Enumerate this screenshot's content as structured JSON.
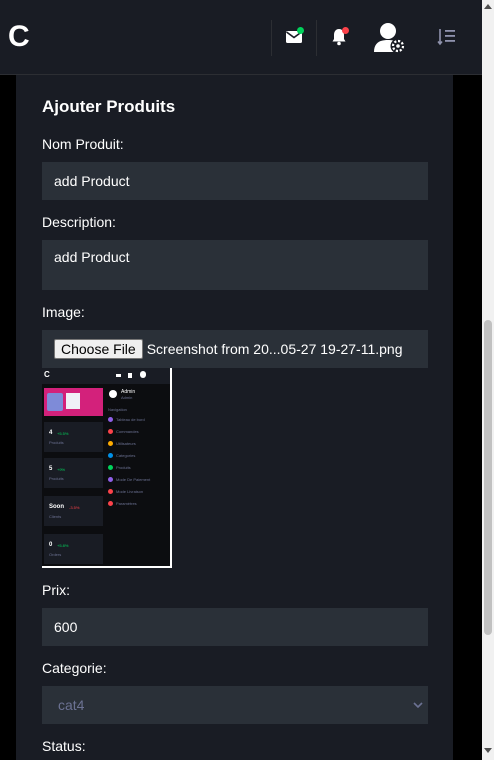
{
  "header": {
    "logo": "C",
    "icons": [
      "mail-icon",
      "bell-icon",
      "user-settings-icon",
      "sort-list-icon"
    ],
    "colors": {
      "mail_badge": "#00d25b",
      "bell_badge": "#fc424a",
      "accent": "#0090e7"
    }
  },
  "form": {
    "title": "Ajouter Produits",
    "name_label": "Nom Produit:",
    "name_value": "add Product",
    "description_label": "Description:",
    "description_value": "add Product",
    "image_label": "Image:",
    "choose_file_label": "Choose File",
    "file_name": "Screenshot from 20...05-27 19-27-11.png",
    "price_label": "Prix:",
    "price_value": "600",
    "category_label": "Categorie:",
    "category_value": "cat4",
    "status_label": "Status:"
  },
  "preview": {
    "logo": "C",
    "admin_name": "Admin",
    "admin_role": "Admin",
    "nav_heading": "Navigation",
    "nav_items": [
      "Tableau de bord",
      "Commandes",
      "Utilisateurs",
      "Categories",
      "Produits",
      "Mode De Paiement",
      "Mode Livraison",
      "Paramètres"
    ],
    "stats": [
      {
        "value": "4",
        "change": "+5.5%",
        "label": "Produits"
      },
      {
        "value": "5",
        "change": "+9%",
        "label": "Produits"
      },
      {
        "value": "Soon",
        "change": "-3.5%",
        "label": "Clients"
      },
      {
        "value": "0",
        "change": "+5.8%",
        "label": "Orders"
      }
    ]
  }
}
